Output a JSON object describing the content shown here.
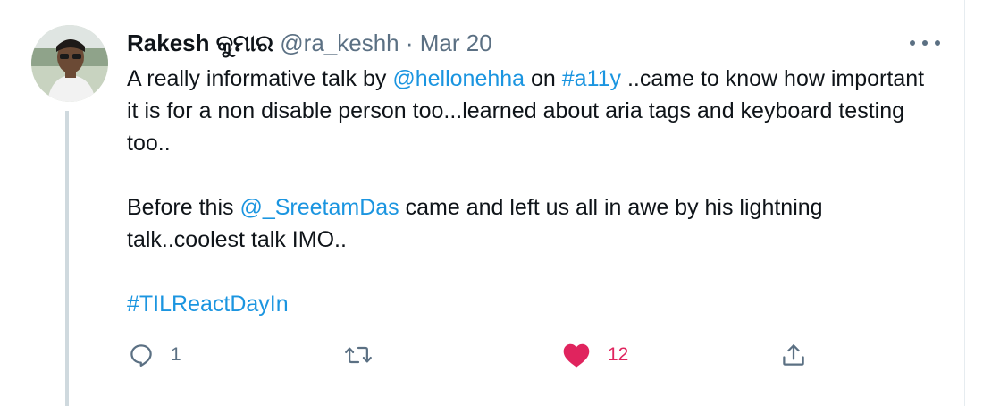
{
  "tweet": {
    "display_name": "Rakesh କୁମାର",
    "handle": "@ra_keshh",
    "separator": "·",
    "date": "Mar 20",
    "body": {
      "line1_pre": "A really informative talk by ",
      "mention1": "@hellonehha",
      "line1_mid": " on ",
      "hashtag1": "#a11y",
      "line1_post": " ..came to know how important it is for a non disable person too...learned about aria tags and keyboard testing too..",
      "para2_pre": "Before this ",
      "mention2": "@_SreetamDas",
      "para2_post": " came and left us all in awe by his lightning talk..coolest talk IMO..",
      "hashtag2": "#TILReactDayIn"
    },
    "actions": {
      "reply_count": "1",
      "retweet_count": "",
      "like_count": "12"
    }
  },
  "colors": {
    "link": "#1b95e0",
    "like": "#e0245e",
    "muted": "#5b7083",
    "thread_line": "#cfd9de"
  },
  "icons": [
    "more-icon",
    "reply-icon",
    "retweet-icon",
    "like-icon",
    "share-icon"
  ]
}
